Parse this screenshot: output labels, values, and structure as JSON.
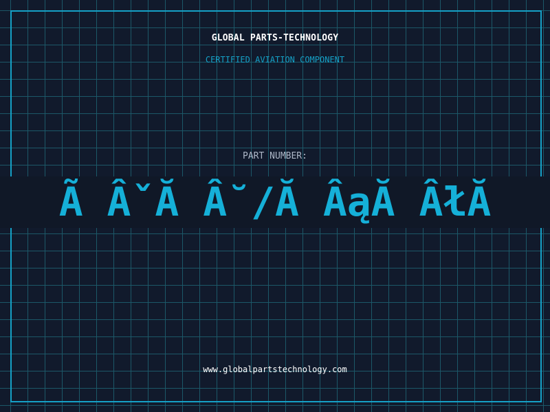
{
  "card": {
    "company": "GLOBAL PARTS-TECHNOLOGY",
    "subtitle": "CERTIFIED AVIATION COMPONENT",
    "part_label": "PART NUMBER:",
    "part_number": "Ã ÂˇĂ Â˘/Ă ÂąĂ ÂłĂ",
    "website": "www.globalpartstechnology.com"
  },
  "colors": {
    "background": "#111a2c",
    "grid": "#1c5868",
    "accent": "#15a1c7",
    "text": "#ffffff"
  }
}
